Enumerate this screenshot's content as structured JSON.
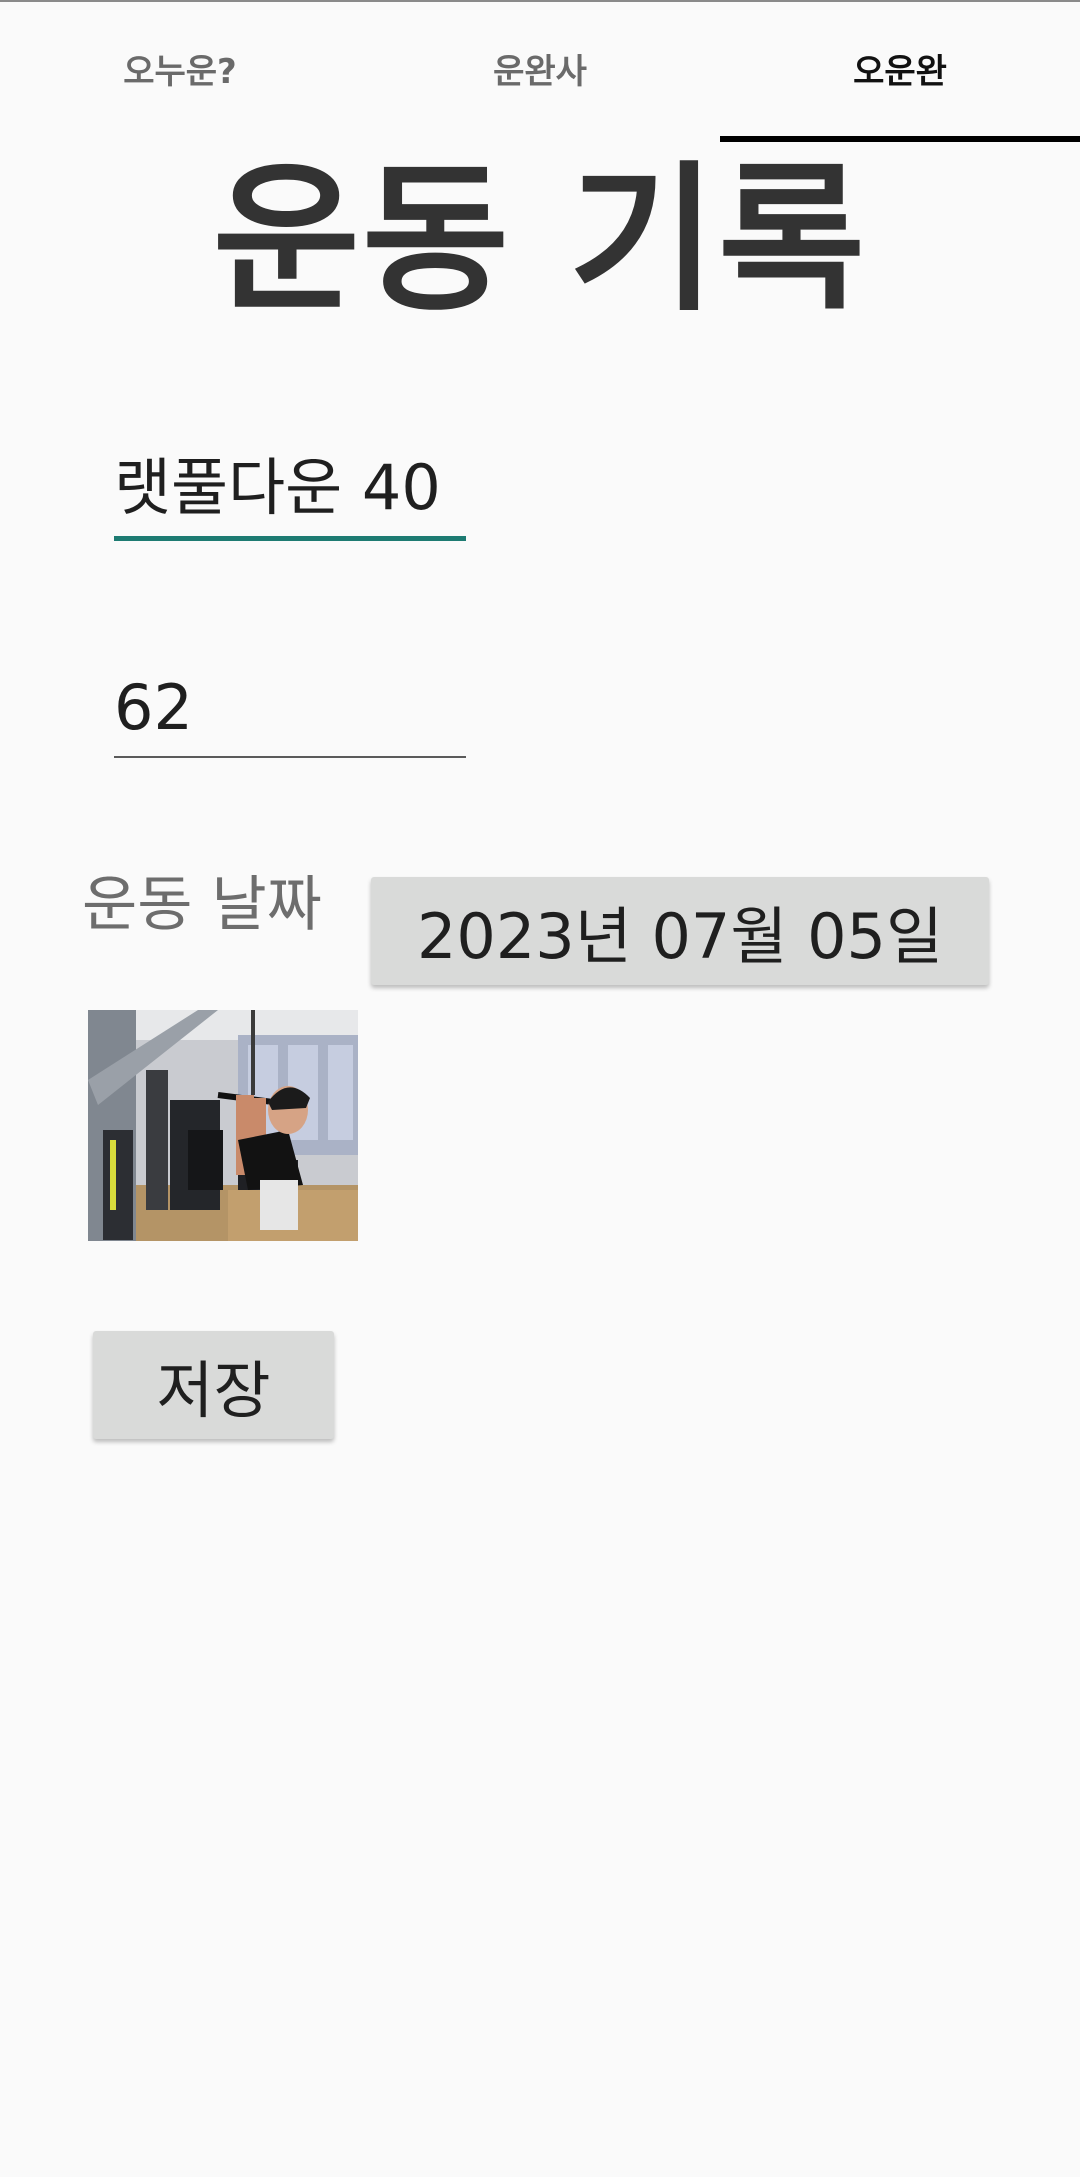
{
  "tabs": [
    {
      "label": "오누운?",
      "active": false
    },
    {
      "label": "운완사",
      "active": false
    },
    {
      "label": "오운완",
      "active": true
    }
  ],
  "page_title": "운동 기록",
  "form": {
    "exercise_name": "랫풀다운 40",
    "reps": "62",
    "date_label": "운동 날짜",
    "date_value": "2023년 07월 05일",
    "save_label": "저장"
  },
  "colors": {
    "accent_underline": "#1d7b72",
    "tab_indicator": "#000000",
    "button_bg": "#d9dad9"
  }
}
